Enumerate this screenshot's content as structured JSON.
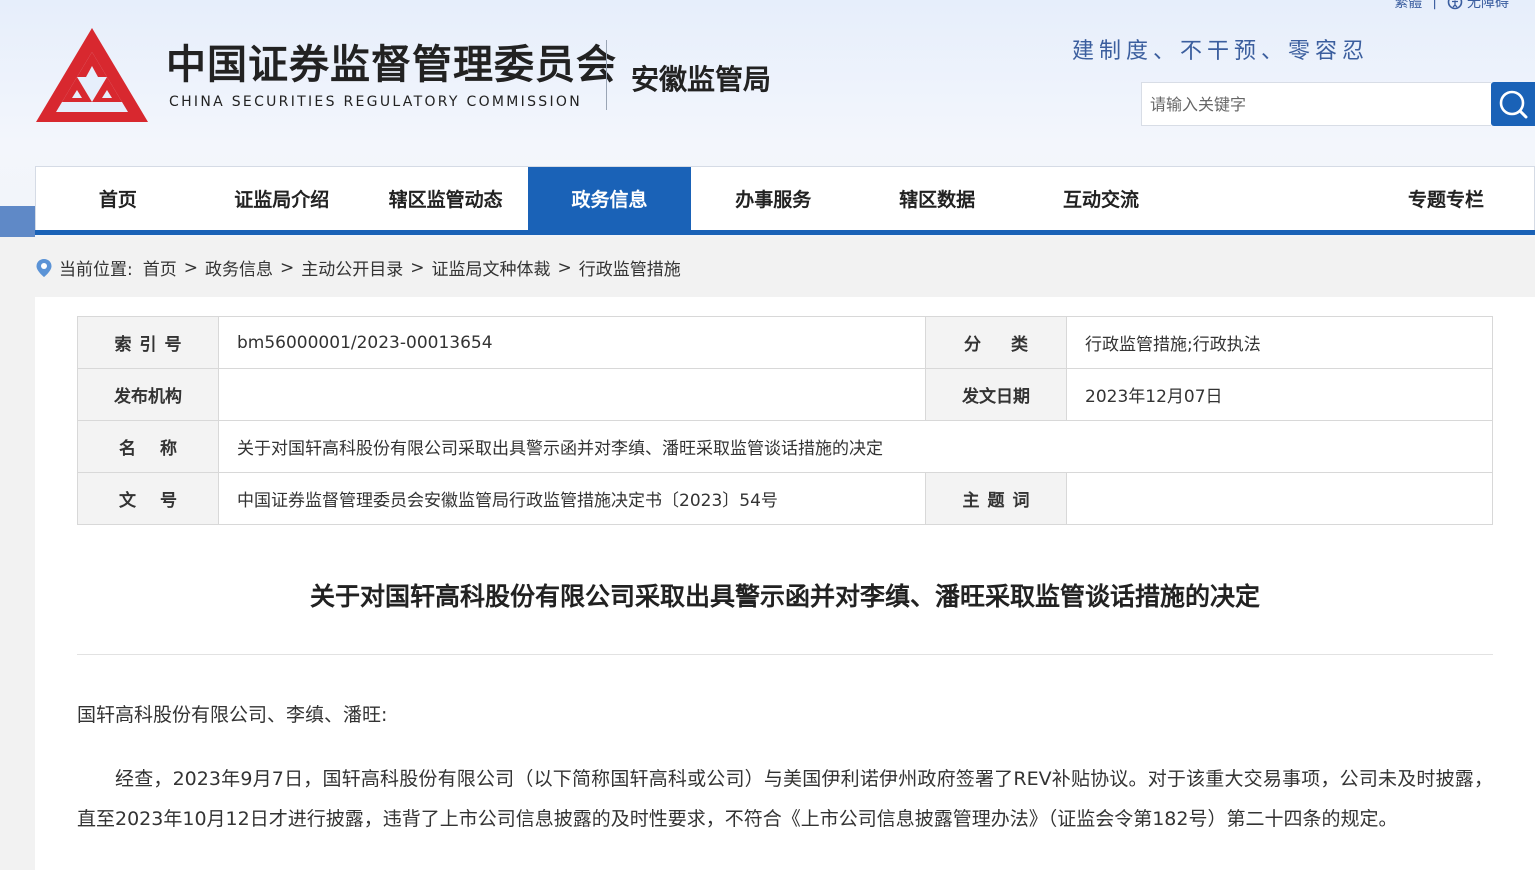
{
  "header": {
    "top_links": {
      "traditional": "繁體",
      "accessibility": "无障碍"
    },
    "org_name_cn": "中国证券监督管理委员会",
    "org_name_en": "CHINA SECURITIES REGULATORY COMMISSION",
    "bureau_name": "安徽监管局",
    "slogan": "建制度、不干预、零容忍",
    "search": {
      "placeholder": "请输入关键字",
      "icon": "search-icon"
    },
    "colors": {
      "brand_red": "#d8282f",
      "brand_blue": "#1a62b7"
    }
  },
  "nav": {
    "items": [
      {
        "label": "首页",
        "active": false
      },
      {
        "label": "证监局介绍",
        "active": false
      },
      {
        "label": "辖区监管动态",
        "active": false
      },
      {
        "label": "政务信息",
        "active": true
      },
      {
        "label": "办事服务",
        "active": false
      },
      {
        "label": "辖区数据",
        "active": false
      },
      {
        "label": "互动交流",
        "active": false
      },
      {
        "label": "专题专栏",
        "active": false
      }
    ]
  },
  "breadcrumb": {
    "prefix": "当前位置:",
    "separator": ">",
    "items": [
      "首页",
      "政务信息",
      "主动公开目录",
      "证监局文种体裁",
      "行政监管措施"
    ]
  },
  "meta": {
    "index_label": "索引号",
    "index_value": "bm56000001/2023-00013654",
    "category_label": "分类",
    "category_value": "行政监管措施;行政执法",
    "publisher_label": "发布机构",
    "publisher_value": "",
    "date_label": "发文日期",
    "date_value": "2023年12月07日",
    "name_label": "名称",
    "name_value": "关于对国轩高科股份有限公司采取出具警示函并对李缜、潘旺采取监管谈话措施的决定",
    "docno_label": "文号",
    "docno_value": "中国证券监督管理委员会安徽监管局行政监管措施决定书〔2023〕54号",
    "subject_label": "主题词",
    "subject_value": ""
  },
  "article": {
    "title": "关于对国轩高科股份有限公司采取出具警示函并对李缜、潘旺采取监管谈话措施的决定",
    "addressee": "国轩高科股份有限公司、李缜、潘旺:",
    "paragraph1": "经查，2023年9月7日，国轩高科股份有限公司（以下简称国轩高科或公司）与美国伊利诺伊州政府签署了REV补贴协议。对于该重大交易事项，公司未及时披露，直至2023年10月12日才进行披露，违背了上市公司信息披露的及时性要求，不符合《上市公司信息披露管理办法》（证监会令第182号）第二十四条的规定。"
  }
}
